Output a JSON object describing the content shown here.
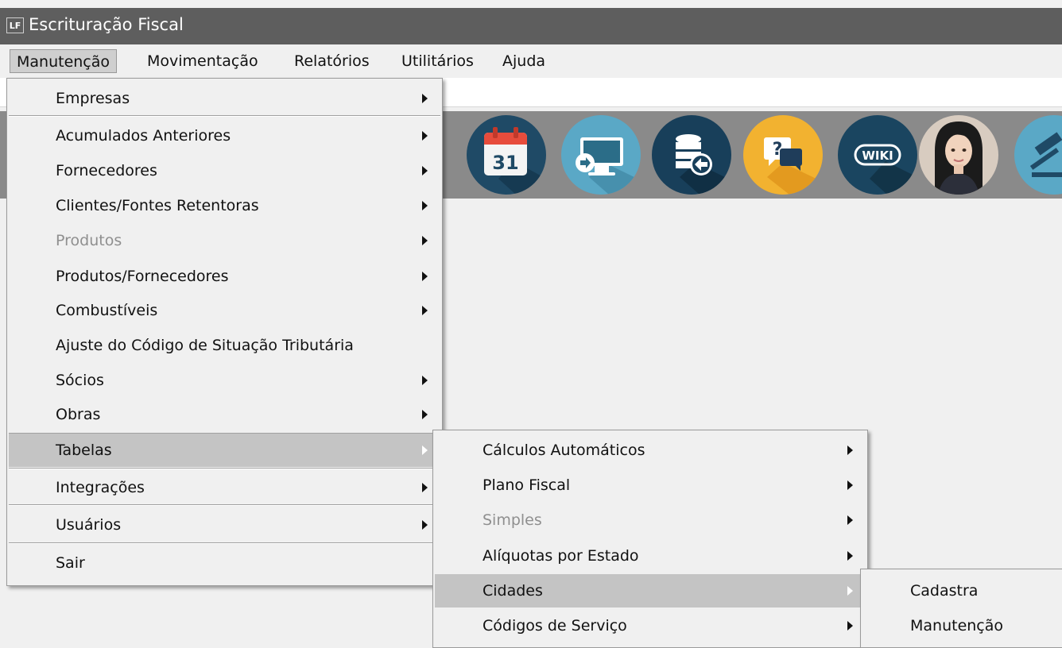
{
  "window": {
    "title": "Escrituração Fiscal",
    "icon_text": "LF"
  },
  "menubar": {
    "items": [
      "Manutenção",
      "Movimentação",
      "Relatórios",
      "Utilitários",
      "Ajuda"
    ]
  },
  "menu_manutencao": {
    "items": [
      {
        "label": "Empresas"
      },
      {
        "label": "Acumulados Anteriores"
      },
      {
        "label": "Fornecedores"
      },
      {
        "label": "Clientes/Fontes Retentoras"
      },
      {
        "label": "Produtos"
      },
      {
        "label": "Produtos/Fornecedores"
      },
      {
        "label": "Combustíveis"
      },
      {
        "label": "Ajuste do Código de Situação Tributária"
      },
      {
        "label": "Sócios"
      },
      {
        "label": "Obras"
      },
      {
        "label": "Tabelas"
      },
      {
        "label": "Integrações"
      },
      {
        "label": "Usuários"
      },
      {
        "label": "Sair"
      }
    ]
  },
  "submenu_tabelas": {
    "items": [
      {
        "label": "Cálculos Automáticos"
      },
      {
        "label": "Plano Fiscal"
      },
      {
        "label": "Simples"
      },
      {
        "label": "Alíquotas por Estado"
      },
      {
        "label": "Cidades"
      },
      {
        "label": "Códigos de Serviço"
      }
    ]
  },
  "submenu_cidades": {
    "items": [
      {
        "label": "Cadastra"
      },
      {
        "label": "Manutenção"
      }
    ]
  },
  "toolbar": {
    "calendar_day": "31",
    "wiki_text": "WIKI",
    "help_text": "?",
    "icons": [
      "teal-partial-icon",
      "calendar-icon",
      "remote-desktop-icon",
      "database-restore-icon",
      "help-chat-icon",
      "wiki-icon",
      "assistant-avatar",
      "gavel-icon"
    ]
  },
  "colors": {
    "titlebar": "#5e5e5e",
    "toolbar": "#8a8a8a",
    "menu_bg": "#f0f0f0",
    "highlight": "#c4c4c4"
  }
}
